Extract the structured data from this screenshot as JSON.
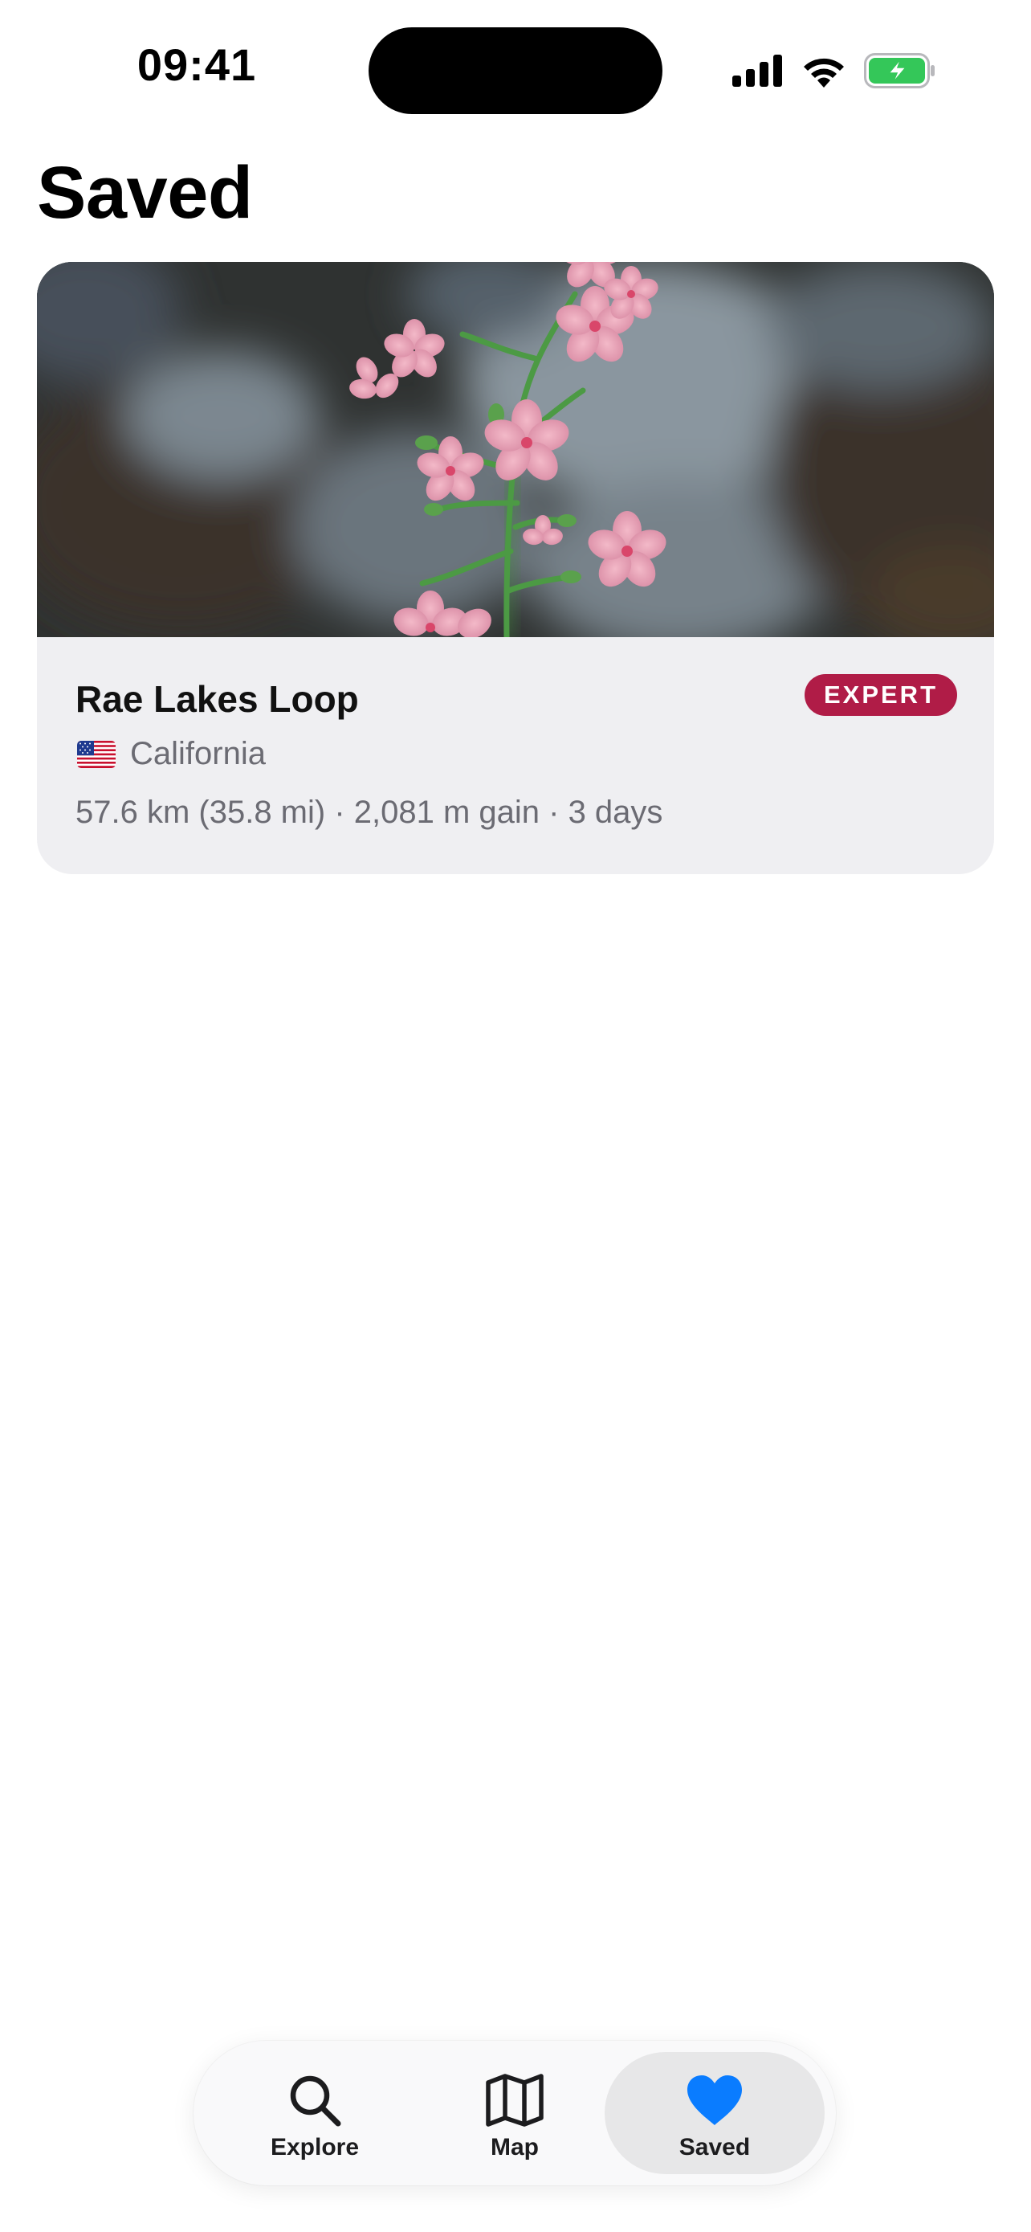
{
  "status_bar": {
    "time": "09:41",
    "icons": [
      "cellular-signal-icon",
      "wifi-icon",
      "battery-charging-icon"
    ],
    "battery_color": "#34c759"
  },
  "page": {
    "title": "Saved"
  },
  "saved_trails": [
    {
      "name": "Rae Lakes Loop",
      "difficulty": "EXPERT",
      "difficulty_color": "#b01c47",
      "region_flag": "us-flag-icon",
      "region": "California",
      "stats": "57.6 km (35.8 mi) · 2,081 m gain · 3 days",
      "photo": "pink-wildflowers-photo"
    }
  ],
  "tab_bar": {
    "tabs": [
      {
        "label": "Explore",
        "icon": "search-icon",
        "active": false
      },
      {
        "label": "Map",
        "icon": "map-icon",
        "active": false
      },
      {
        "label": "Saved",
        "icon": "heart-icon",
        "active": true
      }
    ],
    "active_color": "#0a7cff"
  }
}
